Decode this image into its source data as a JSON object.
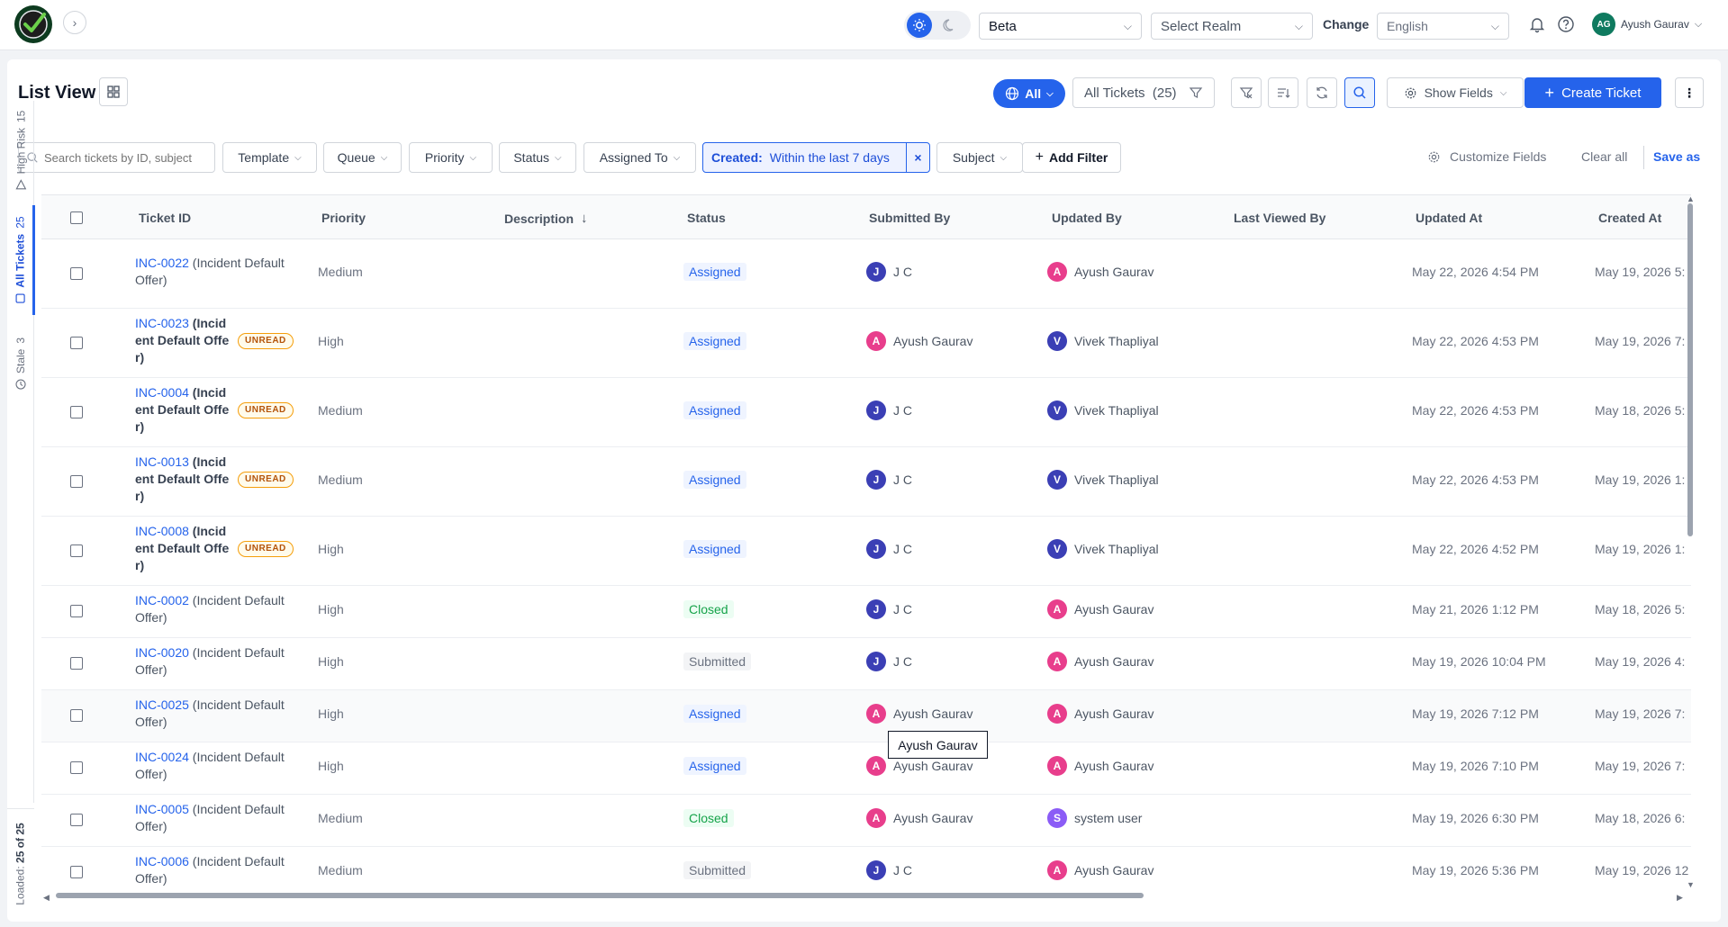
{
  "header": {
    "environment": "Beta",
    "realm_placeholder": "Select Realm",
    "change_label": "Change",
    "language": "English",
    "user_initials": "AG",
    "user_name": "Ayush Gaurav"
  },
  "toolbar": {
    "title": "List View",
    "scope_label": "All",
    "view_name": "All Tickets",
    "view_count": "(25)",
    "show_fields_label": "Show Fields",
    "create_label": "Create Ticket"
  },
  "filters": {
    "search_placeholder": "Search tickets by ID, subject",
    "template": "Template",
    "queue": "Queue",
    "priority": "Priority",
    "status": "Status",
    "assigned_to": "Assigned To",
    "created_label": "Created:",
    "created_value": "Within the last 7 days",
    "subject": "Subject",
    "add_filter": "Add Filter",
    "customize_fields": "Customize Fields",
    "clear_all": "Clear all",
    "save_as": "Save as"
  },
  "rail": {
    "high_risk_label": "High Risk",
    "high_risk_count": "15",
    "all_tickets_label": "All Tickets",
    "all_tickets_count": "25",
    "stale_label": "Stale",
    "stale_count": "3",
    "loaded_label": "Loaded:",
    "loaded_value": "25 of 25"
  },
  "columns": {
    "ticket_id": "Ticket ID",
    "priority": "Priority",
    "description": "Description",
    "status": "Status",
    "submitted_by": "Submitted By",
    "updated_by": "Updated By",
    "last_viewed_by": "Last Viewed By",
    "updated_at": "Updated At",
    "created_at": "Created At"
  },
  "colors": {
    "primary": "#2563eb",
    "avatar_j": "#3b3fb5",
    "avatar_a": "#e83e8c",
    "avatar_v": "#3b3fb5",
    "avatar_s": "#8b5cf6"
  },
  "rows": [
    {
      "id": "INC-0022",
      "desc": " (Incident Default Offer)",
      "unread": false,
      "priority": "Medium",
      "status": "Assigned",
      "submitted_initial": "J",
      "submitted": "J C",
      "updated_initial": "A",
      "updated": "Ayush Gaurav",
      "updated_at": "May 22, 2026 4:54 PM",
      "created_at": "May 19, 2026 5:"
    },
    {
      "id": "INC-0023",
      "desc": " (Incident Default Offer)",
      "unread": true,
      "unread_label": "UNREAD",
      "priority": "High",
      "status": "Assigned",
      "submitted_initial": "A",
      "submitted": "Ayush Gaurav",
      "updated_initial": "V",
      "updated": "Vivek Thapliyal",
      "updated_at": "May 22, 2026 4:53 PM",
      "created_at": "May 19, 2026 7:"
    },
    {
      "id": "INC-0004",
      "desc": " (Incident Default Offer)",
      "unread": true,
      "unread_label": "UNREAD",
      "priority": "Medium",
      "status": "Assigned",
      "submitted_initial": "J",
      "submitted": "J C",
      "updated_initial": "V",
      "updated": "Vivek Thapliyal",
      "updated_at": "May 22, 2026 4:53 PM",
      "created_at": "May 18, 2026 5:"
    },
    {
      "id": "INC-0013",
      "desc": " (Incident Default Offer)",
      "unread": true,
      "unread_label": "UNREAD",
      "priority": "Medium",
      "status": "Assigned",
      "submitted_initial": "J",
      "submitted": "J C",
      "updated_initial": "V",
      "updated": "Vivek Thapliyal",
      "updated_at": "May 22, 2026 4:53 PM",
      "created_at": "May 19, 2026 1:"
    },
    {
      "id": "INC-0008",
      "desc": " (Incident Default Offer)",
      "unread": true,
      "unread_label": "UNREAD",
      "priority": "High",
      "status": "Assigned",
      "submitted_initial": "J",
      "submitted": "J C",
      "updated_initial": "V",
      "updated": "Vivek Thapliyal",
      "updated_at": "May 22, 2026 4:52 PM",
      "created_at": "May 19, 2026 1:"
    },
    {
      "id": "INC-0002",
      "desc": " (Incident Default Offer)",
      "unread": false,
      "priority": "High",
      "status": "Closed",
      "submitted_initial": "J",
      "submitted": "J C",
      "updated_initial": "A",
      "updated": "Ayush Gaurav",
      "updated_at": "May 21, 2026 1:12 PM",
      "created_at": "May 18, 2026 5:"
    },
    {
      "id": "INC-0020",
      "desc": " (Incident Default Offer)",
      "unread": false,
      "priority": "High",
      "status": "Submitted",
      "submitted_initial": "J",
      "submitted": "J C",
      "updated_initial": "A",
      "updated": "Ayush Gaurav",
      "updated_at": "May 19, 2026 10:04 PM",
      "created_at": "May 19, 2026 4:"
    },
    {
      "id": "INC-0025",
      "desc": " (Incident Default Offer)",
      "unread": false,
      "priority": "High",
      "status": "Assigned",
      "submitted_initial": "A",
      "submitted": "Ayush Gaurav",
      "updated_initial": "A",
      "updated": "Ayush Gaurav",
      "updated_at": "May 19, 2026 7:12 PM",
      "created_at": "May 19, 2026 7:"
    },
    {
      "id": "INC-0024",
      "desc": " (Incident Default Offer)",
      "unread": false,
      "priority": "High",
      "status": "Assigned",
      "submitted_initial": "A",
      "submitted": "Ayush Gaurav",
      "updated_initial": "A",
      "updated": "Ayush Gaurav",
      "updated_at": "May 19, 2026 7:10 PM",
      "created_at": "May 19, 2026 7:"
    },
    {
      "id": "INC-0005",
      "desc": " (Incident Default Offer)",
      "unread": false,
      "priority": "Medium",
      "status": "Closed",
      "submitted_initial": "A",
      "submitted": "Ayush Gaurav",
      "updated_initial": "S",
      "updated": "system user",
      "updated_at": "May 19, 2026 6:30 PM",
      "created_at": "May 18, 2026 6:"
    },
    {
      "id": "INC-0006",
      "desc": " (Incident Default Offer)",
      "unread": false,
      "priority": "Medium",
      "status": "Submitted",
      "submitted_initial": "J",
      "submitted": "J C",
      "updated_initial": "A",
      "updated": "Ayush Gaurav",
      "updated_at": "May 19, 2026 5:36 PM",
      "created_at": "May 19, 2026 12"
    }
  ],
  "tooltip": "Ayush Gaurav"
}
